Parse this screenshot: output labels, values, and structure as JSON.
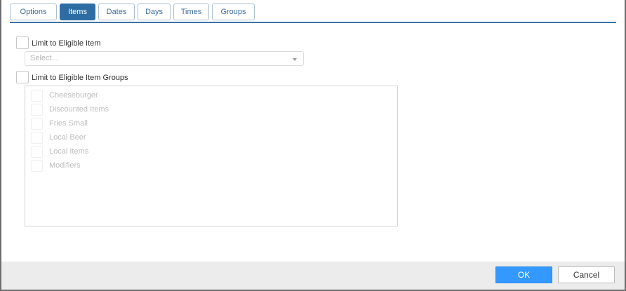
{
  "tabs": [
    {
      "label": "Options",
      "active": false
    },
    {
      "label": "Items",
      "active": true
    },
    {
      "label": "Dates",
      "active": false
    },
    {
      "label": "Days",
      "active": false
    },
    {
      "label": "Times",
      "active": false
    },
    {
      "label": "Groups",
      "active": false
    }
  ],
  "eligible_item": {
    "label": "Limit to Eligible Item",
    "checked": false,
    "select_placeholder": "Select..."
  },
  "eligible_groups": {
    "label": "Limit to Eligible Item Groups",
    "checked": false,
    "items": [
      {
        "label": "Cheeseburger",
        "checked": false
      },
      {
        "label": "Discounted Items",
        "checked": false
      },
      {
        "label": "Fries Small",
        "checked": false
      },
      {
        "label": "Local Beer",
        "checked": false
      },
      {
        "label": "Local Items",
        "checked": false
      },
      {
        "label": "Modifiers",
        "checked": false
      }
    ]
  },
  "footer": {
    "ok_label": "OK",
    "cancel_label": "Cancel"
  },
  "colors": {
    "tab_active": "#2e6da4",
    "tab_text": "#3c6fa0",
    "ok_button": "#3399ff",
    "footer_bg": "#ececec"
  }
}
